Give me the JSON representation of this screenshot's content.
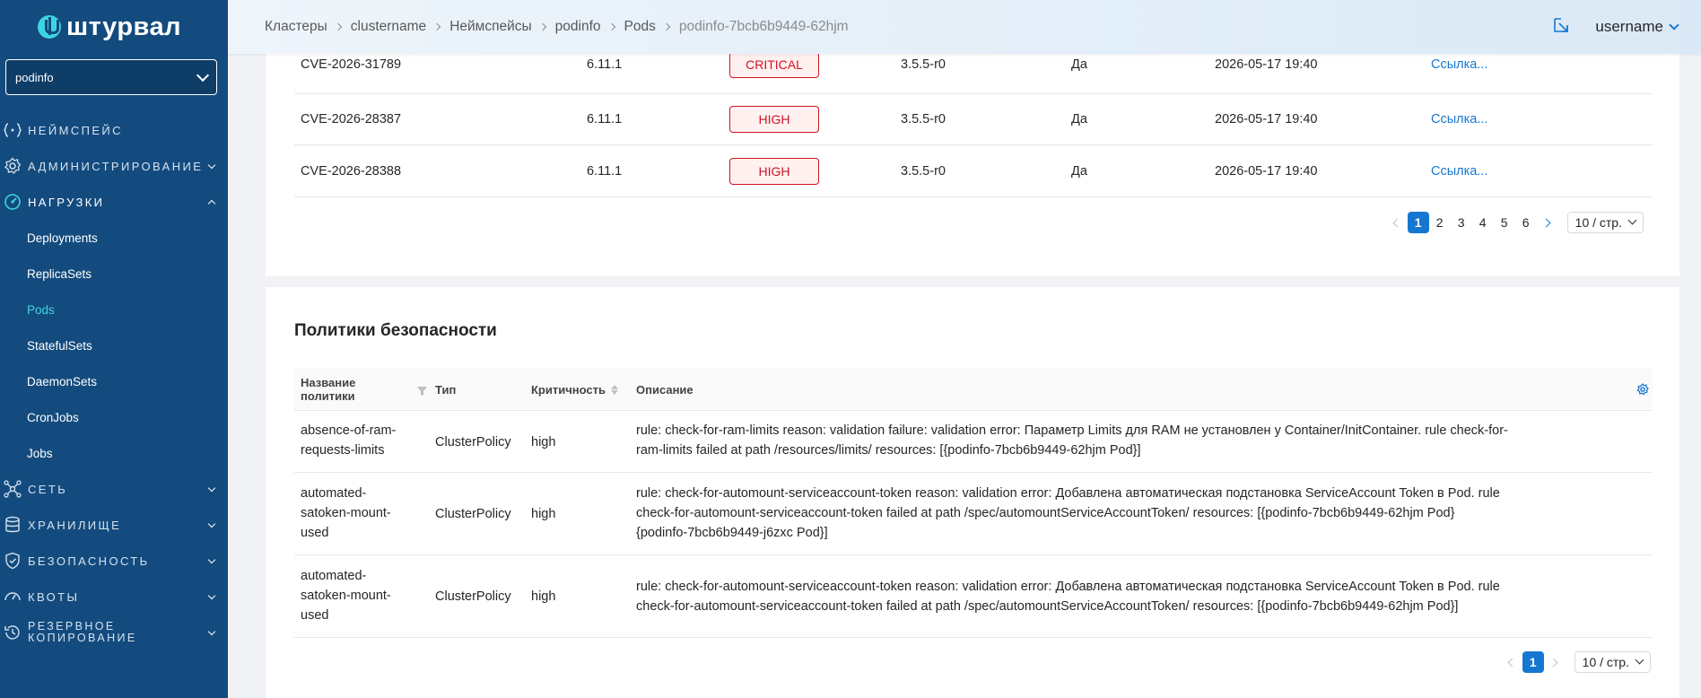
{
  "brand": {
    "name": "штурвал"
  },
  "namespace_select": {
    "value": "podinfo"
  },
  "sidebar": {
    "items": [
      {
        "label": "Неймспейс",
        "icon": "braces-icon"
      },
      {
        "label": "Администрирование",
        "icon": "gear-icon"
      },
      {
        "label": "Нагрузки",
        "icon": "dashboard-icon"
      },
      {
        "label": "Сеть",
        "icon": "network-icon"
      },
      {
        "label": "Хранилище",
        "icon": "database-icon"
      },
      {
        "label": "Безопасность",
        "icon": "shield-icon"
      },
      {
        "label": "Квоты",
        "icon": "gauge-icon"
      },
      {
        "label_1": "Резервное",
        "label_2": "копирование",
        "icon": "backup-icon"
      }
    ],
    "workloads": [
      "Deployments",
      "ReplicaSets",
      "Pods",
      "StatefulSets",
      "DaemonSets",
      "CronJobs",
      "Jobs"
    ]
  },
  "header": {
    "breadcrumbs": [
      "Кластеры",
      "clustername",
      "Неймспейсы",
      "podinfo",
      "Pods",
      "podinfo-7bcb6b9449-62hjm"
    ],
    "username": "username"
  },
  "vulnerabilities": {
    "rows": [
      {
        "id": "CVE-2026-31789",
        "installed": "6.11.1",
        "severity": "CRITICAL",
        "fixed": "3.5.5-r0",
        "fixable": "Да",
        "date": "2026-05-17 19:40",
        "link": "Ссылка..."
      },
      {
        "id": "CVE-2026-28387",
        "installed": "6.11.1",
        "severity": "HIGH",
        "fixed": "3.5.5-r0",
        "fixable": "Да",
        "date": "2026-05-17 19:40",
        "link": "Ссылка..."
      },
      {
        "id": "CVE-2026-28388",
        "installed": "6.11.1",
        "severity": "HIGH",
        "fixed": "3.5.5-r0",
        "fixable": "Да",
        "date": "2026-05-17 19:40",
        "link": "Ссылка..."
      }
    ],
    "pagination": {
      "pages": [
        "1",
        "2",
        "3",
        "4",
        "5",
        "6"
      ],
      "page_size": "10 / стр."
    }
  },
  "policies": {
    "title": "Политики безопасности",
    "columns": {
      "name_1": "Название",
      "name_2": "политики",
      "type": "Тип",
      "severity": "Критичность",
      "description": "Описание"
    },
    "rows": [
      {
        "name": [
          "absence-of-ram-",
          "requests-limits"
        ],
        "type": "ClusterPolicy",
        "severity": "high",
        "description": [
          "rule: check-for-ram-limits reason: validation failure: validation error: Параметр Limits для RAM не установлен у Container/InitContainer. rule check-for-",
          "ram-limits failed at path /resources/limits/ resources: [{podinfo-7bcb6b9449-62hjm Pod}]"
        ]
      },
      {
        "name": [
          "automated-",
          "satoken-mount-",
          "used"
        ],
        "type": "ClusterPolicy",
        "severity": "high",
        "description": [
          "rule: check-for-automount-serviceaccount-token reason: validation error: Добавлена автоматическая подстановка ServiceAccount Token в Pod. rule",
          "check-for-automount-serviceaccount-token failed at path /spec/automountServiceAccountToken/ resources: [{podinfo-7bcb6b9449-62hjm Pod}",
          "{podinfo-7bcb6b9449-j6zxc Pod}]"
        ]
      },
      {
        "name": [
          "automated-",
          "satoken-mount-",
          "used"
        ],
        "type": "ClusterPolicy",
        "severity": "high",
        "description": [
          "rule: check-for-automount-serviceaccount-token reason: validation error: Добавлена автоматическая подстановка ServiceAccount Token в Pod. rule",
          "check-for-automount-serviceaccount-token failed at path /spec/automountServiceAccountToken/ resources: [{podinfo-7bcb6b9449-62hjm Pod}]"
        ]
      }
    ],
    "pagination": {
      "current": "1",
      "page_size": "10 / стр."
    }
  },
  "colors": {
    "sidebar": "#134b7e",
    "accent": "#1677d2",
    "active_sub": "#3fd3e0",
    "danger": "#cf1322"
  }
}
